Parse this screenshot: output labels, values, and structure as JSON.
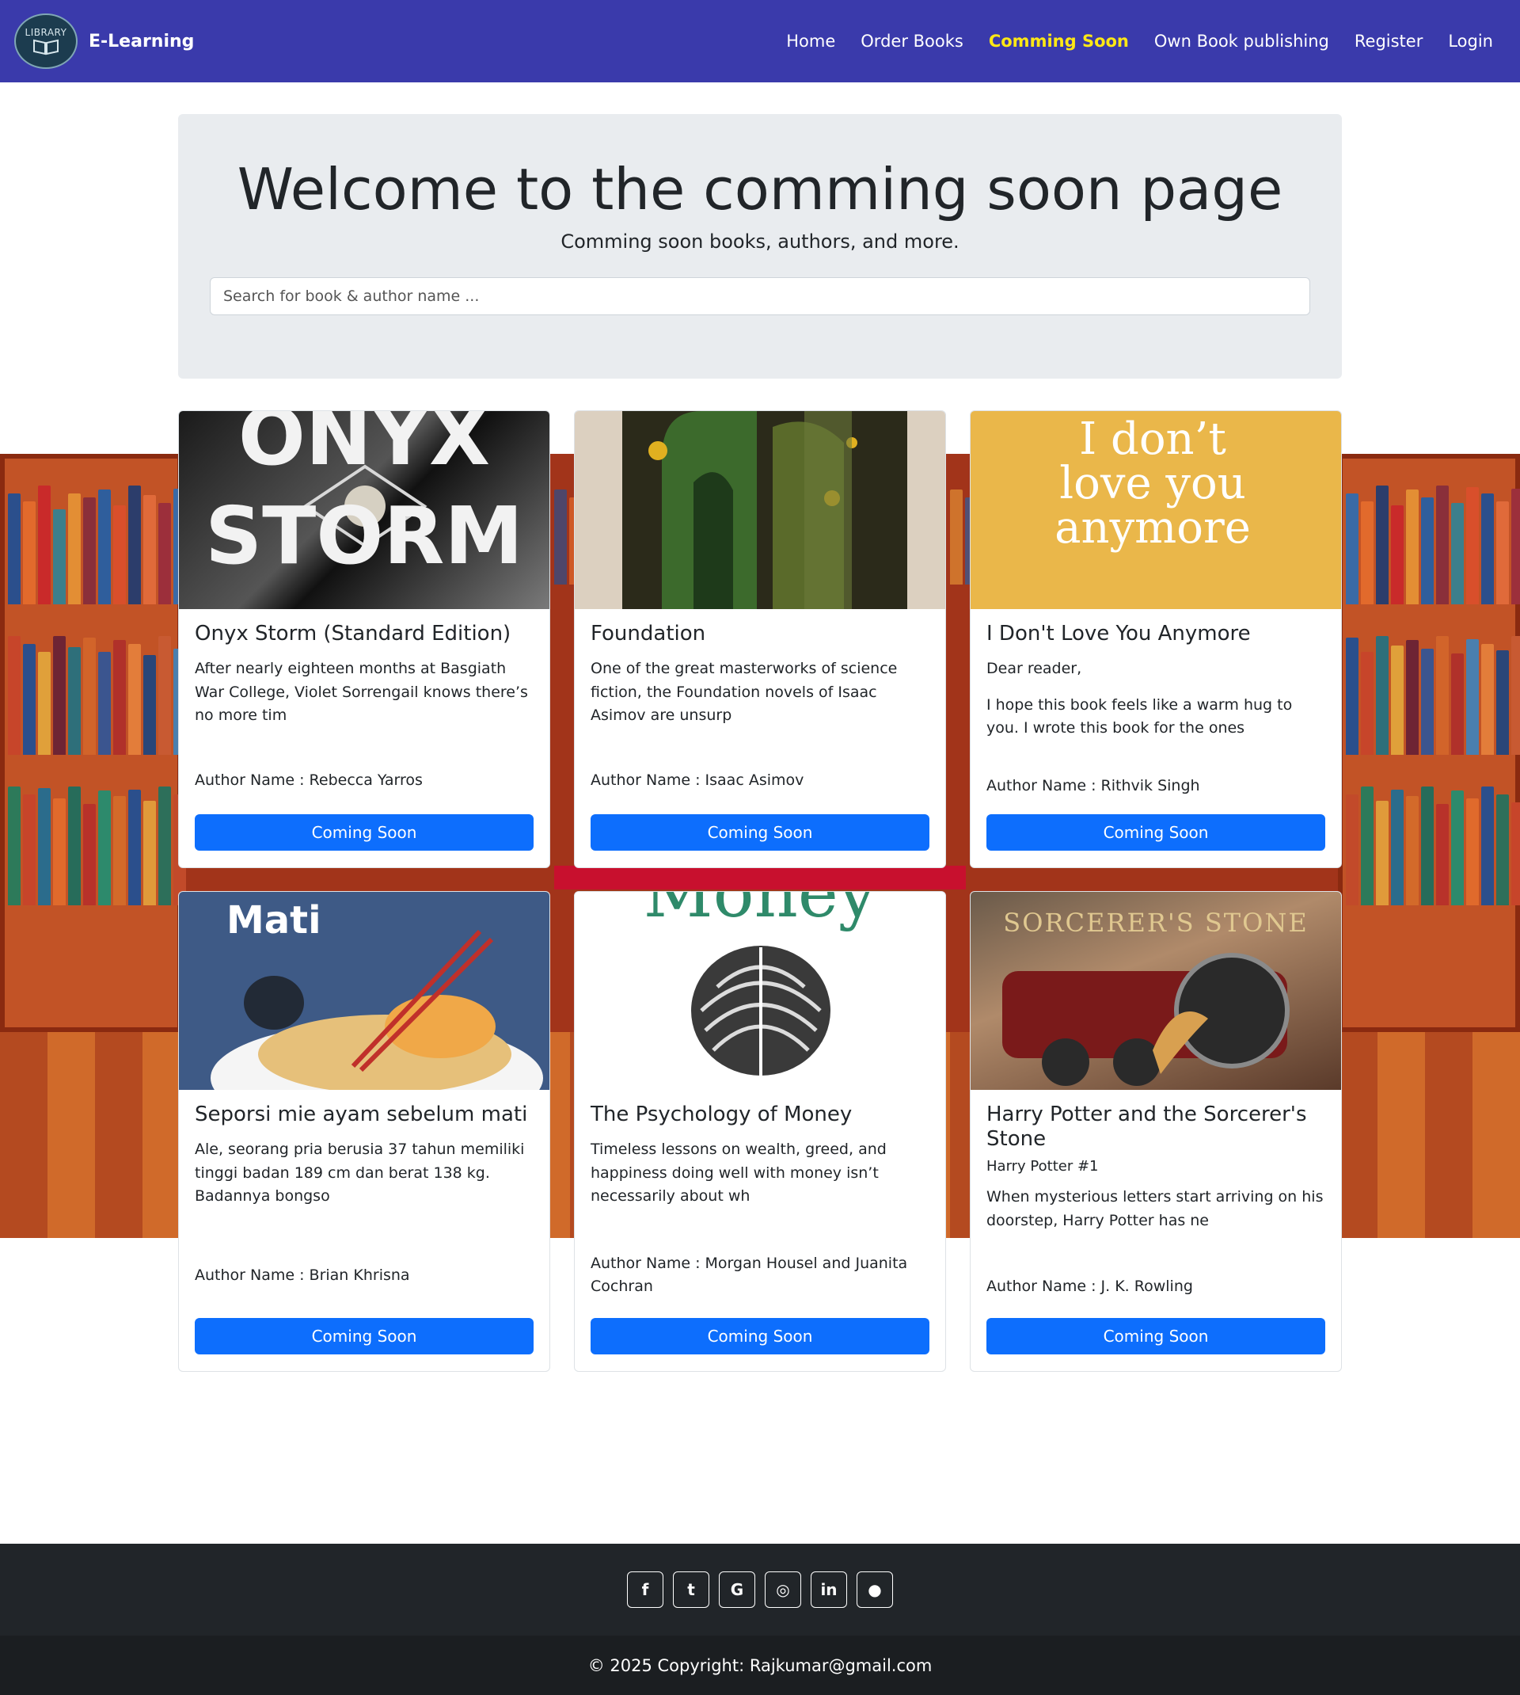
{
  "nav": {
    "logo_text": "LIBRARY",
    "brand": "E-Learning",
    "links": [
      {
        "label": "Home"
      },
      {
        "label": "Order Books"
      },
      {
        "label": "Comming Soon"
      },
      {
        "label": "Own Book publishing"
      },
      {
        "label": "Register"
      },
      {
        "label": "Login"
      }
    ],
    "active_color": "#ffe815",
    "background": "#3a3aab"
  },
  "hero": {
    "title": "Welcome to the comming soon page",
    "subtitle": "Comming soon books, authors, and more.",
    "search_placeholder": "Search for book & author name ..."
  },
  "cards": [
    {
      "cover_text": "ONYX STORM",
      "title": "Onyx Storm (Standard Edition)",
      "description": "After nearly eighteen months at Basgiath War College, Violet Sorrengail knows there’s no more tim",
      "author": "Author Name : Rebecca Yarros",
      "button": "Coming Soon"
    },
    {
      "cover_text": "",
      "title": "Foundation",
      "description": "One of the great masterworks of science fiction, the Foundation novels of Isaac Asimov are unsurp",
      "author": "Author Name : Isaac Asimov",
      "button": "Coming Soon"
    },
    {
      "cover_text": "I don’t love you anymore",
      "title": "I Don't Love You Anymore",
      "description_line1": "Dear reader,",
      "description": "I hope this book feels like a warm hug to you. I wrote this book for the ones",
      "author": "Author Name : Rithvik Singh",
      "button": "Coming Soon"
    },
    {
      "cover_text": "Mati",
      "title": "Seporsi mie ayam sebelum mati",
      "description": "Ale, seorang pria berusia 37 tahun memiliki tinggi badan 189 cm dan berat 138 kg. Badannya bongso",
      "author": "Author Name : Brian Khrisna",
      "button": "Coming Soon"
    },
    {
      "cover_text": "Money",
      "title": "The Psychology of Money",
      "description": "Timeless lessons on wealth, greed, and happiness doing well with money isn’t necessarily about wh",
      "author": "Author Name : Morgan Housel and Juanita Cochran",
      "button": "Coming Soon"
    },
    {
      "cover_text": "SORCERER'S STONE",
      "title": "Harry Potter and the Sorcerer's Stone",
      "subtitle": "Harry Potter #1",
      "description": "When mysterious letters start arriving on his doorstep, Harry Potter has ne",
      "author": "Author Name : J. K. Rowling",
      "button": "Coming Soon"
    }
  ],
  "footer": {
    "social": [
      {
        "icon": "facebook-icon",
        "glyph": "f"
      },
      {
        "icon": "twitter-icon",
        "glyph": "t"
      },
      {
        "icon": "google-icon",
        "glyph": "G"
      },
      {
        "icon": "instagram-icon",
        "glyph": "◎"
      },
      {
        "icon": "linkedin-icon",
        "glyph": "in"
      },
      {
        "icon": "github-icon",
        "glyph": "●"
      }
    ],
    "copyright": "© 2025 Copyright: Rajkumar@gmail.com"
  },
  "colors": {
    "button": "#0d6efd",
    "footer": "#212529",
    "jumbotron": "#e9ecef"
  }
}
